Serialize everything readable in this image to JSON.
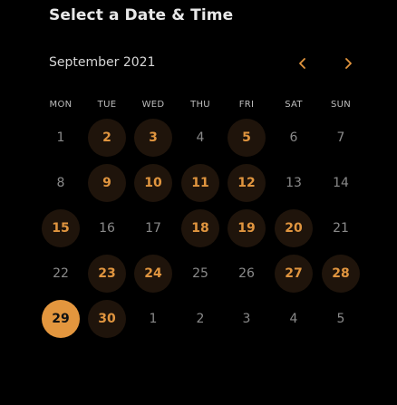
{
  "header": {
    "title": "Select a Date & Time"
  },
  "calendar": {
    "month_label": "September 2021",
    "prev_icon": "chevron-left-icon",
    "next_icon": "chevron-right-icon",
    "accent_color": "#e3963e",
    "weekdays": [
      "MON",
      "TUE",
      "WED",
      "THU",
      "FRI",
      "SAT",
      "SUN"
    ],
    "selected_day": "29",
    "weeks": [
      [
        {
          "label": "1",
          "state": "unavailable"
        },
        {
          "label": "2",
          "state": "available"
        },
        {
          "label": "3",
          "state": "available"
        },
        {
          "label": "4",
          "state": "unavailable"
        },
        {
          "label": "5",
          "state": "available"
        },
        {
          "label": "6",
          "state": "unavailable"
        },
        {
          "label": "7",
          "state": "unavailable"
        }
      ],
      [
        {
          "label": "8",
          "state": "unavailable"
        },
        {
          "label": "9",
          "state": "available"
        },
        {
          "label": "10",
          "state": "available"
        },
        {
          "label": "11",
          "state": "available"
        },
        {
          "label": "12",
          "state": "available"
        },
        {
          "label": "13",
          "state": "unavailable"
        },
        {
          "label": "14",
          "state": "unavailable"
        }
      ],
      [
        {
          "label": "15",
          "state": "available"
        },
        {
          "label": "16",
          "state": "unavailable"
        },
        {
          "label": "17",
          "state": "unavailable"
        },
        {
          "label": "18",
          "state": "available"
        },
        {
          "label": "19",
          "state": "available"
        },
        {
          "label": "20",
          "state": "available"
        },
        {
          "label": "21",
          "state": "unavailable"
        }
      ],
      [
        {
          "label": "22",
          "state": "unavailable"
        },
        {
          "label": "23",
          "state": "available"
        },
        {
          "label": "24",
          "state": "available"
        },
        {
          "label": "25",
          "state": "unavailable"
        },
        {
          "label": "26",
          "state": "unavailable"
        },
        {
          "label": "27",
          "state": "available"
        },
        {
          "label": "28",
          "state": "available"
        }
      ],
      [
        {
          "label": "29",
          "state": "selected"
        },
        {
          "label": "30",
          "state": "available"
        },
        {
          "label": "1",
          "state": "other-month"
        },
        {
          "label": "2",
          "state": "other-month"
        },
        {
          "label": "3",
          "state": "other-month"
        },
        {
          "label": "4",
          "state": "other-month"
        },
        {
          "label": "5",
          "state": "other-month"
        }
      ]
    ]
  }
}
